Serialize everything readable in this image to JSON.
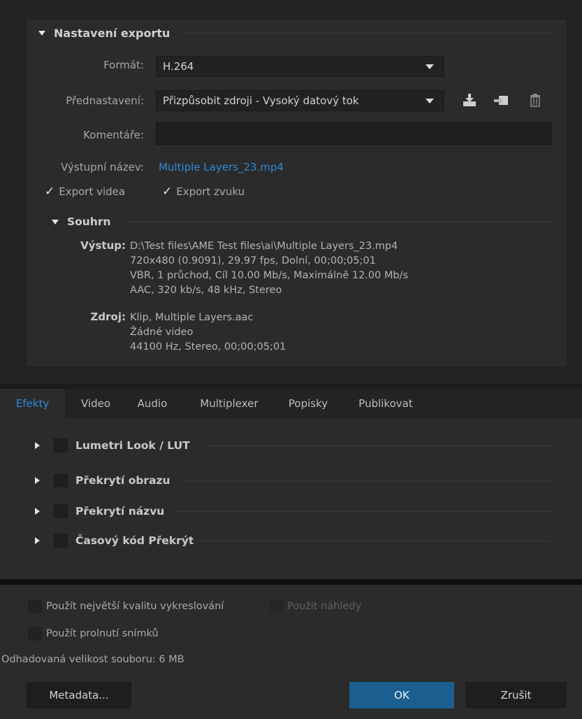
{
  "export_settings": {
    "section_title": "Nastavení exportu",
    "format_label": "Formát:",
    "format_value": "H.264",
    "preset_label": "Přednastavení:",
    "preset_value": "Přizpůsobit zdroji - Vysoký datový tok",
    "comments_label": "Komentáře:",
    "comments_value": "",
    "output_name_label": "Výstupní název:",
    "output_name_value": "Multiple Layers_23.mp4",
    "export_video_label": "Export videa",
    "export_video_checked": true,
    "export_audio_label": "Export zvuku",
    "export_audio_checked": true,
    "icons": [
      "save-preset-icon",
      "import-preset-icon",
      "delete-preset-icon"
    ]
  },
  "summary": {
    "title": "Souhrn",
    "output_label": "Výstup:",
    "output_lines": [
      "D:\\Test files\\AME Test files\\ai\\Multiple Layers_23.mp4",
      "720x480 (0.9091), 29.97 fps, Dolní, 00;00;05;01",
      "VBR, 1 průchod, Cíl 10.00 Mb/s, Maximálně 12.00 Mb/s",
      "AAC, 320 kb/s, 48 kHz, Stereo"
    ],
    "source_label": "Zdroj:",
    "source_lines": [
      "Klip, Multiple Layers.aac",
      "Žádné video",
      "44100 Hz, Stereo, 00;00;05;01"
    ]
  },
  "tabs": [
    {
      "label": "Efekty",
      "active": true
    },
    {
      "label": "Video",
      "active": false
    },
    {
      "label": "Audio",
      "active": false
    },
    {
      "label": "Multiplexer",
      "active": false
    },
    {
      "label": "Popisky",
      "active": false
    },
    {
      "label": "Publikovat",
      "active": false
    }
  ],
  "effects": [
    {
      "label": "Lumetri Look / LUT",
      "checked": false
    },
    {
      "label": "Překrytí obrazu",
      "checked": false
    },
    {
      "label": "Překrytí názvu",
      "checked": false
    },
    {
      "label": "Časový kód Překrýt",
      "checked": false
    }
  ],
  "bottom": {
    "max_render_quality_label": "Použít největší kvalitu vykreslování",
    "use_previews_label": "Použít náhledy",
    "frame_blending_label": "Použít prolnutí snímků",
    "estimated_size_label": "Odhadovaná velikost souboru:",
    "estimated_size_value": "6 MB"
  },
  "buttons": {
    "metadata": "Metadata...",
    "ok": "OK",
    "cancel": "Zrušit"
  },
  "colors": {
    "accent_blue": "#2e8ad8",
    "ok_button": "#1a5f8f",
    "panel_bg": "#2b2b2b"
  }
}
